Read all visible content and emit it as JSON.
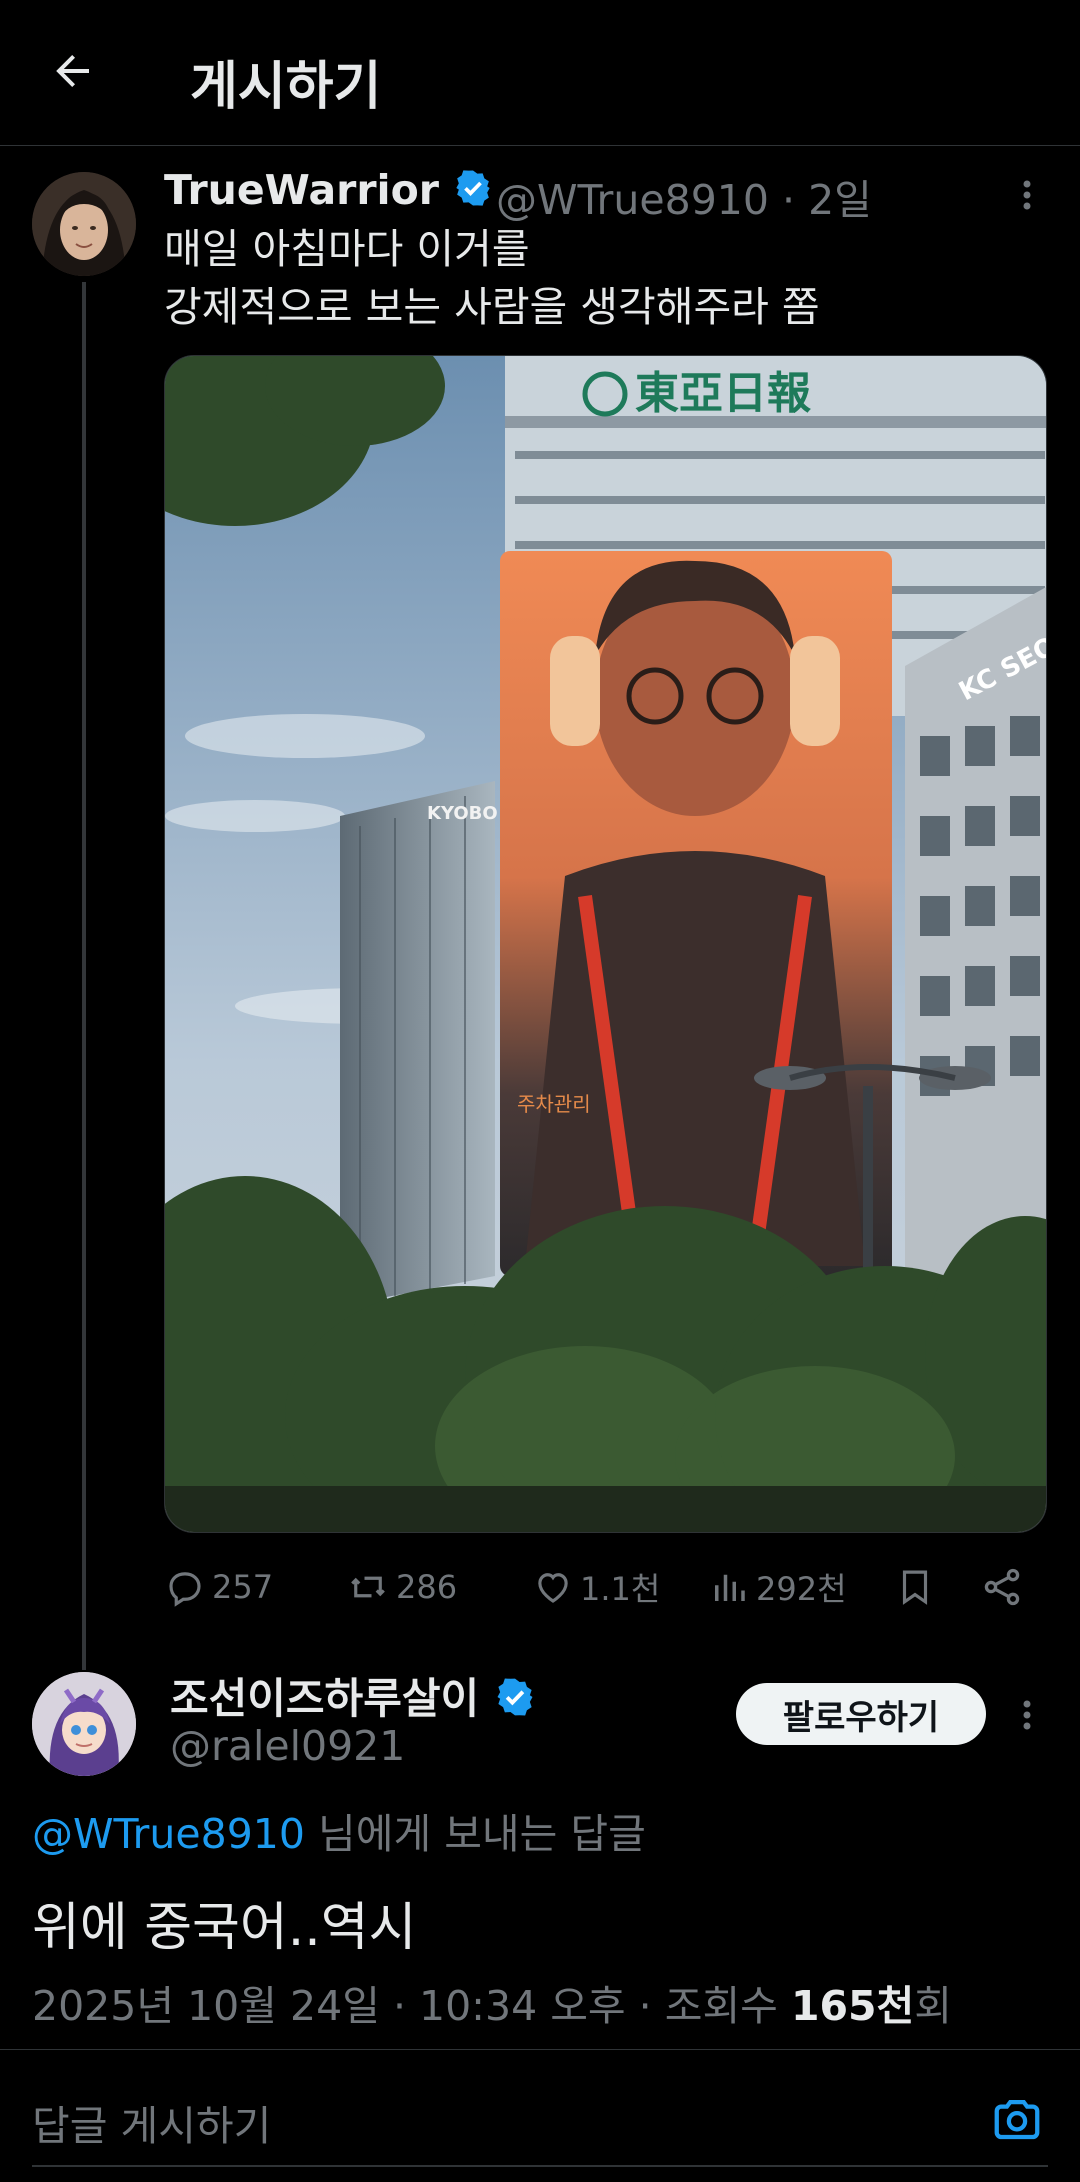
{
  "header": {
    "title": "게시하기"
  },
  "parent_tweet": {
    "display_name": "TrueWarrior",
    "handle": "@WTrue8910",
    "time": "· 2일",
    "text_line1": "매일 아침마다 이거를",
    "text_line2": "강제적으로 보는 사람을 생각해주라 쫌",
    "media": {
      "building_sign": "東亞日報",
      "kyobo_sign": "KYOBO",
      "seoul_sign": "KC SEOUL",
      "billboard_caption": "주차관리"
    },
    "actions": {
      "replies": "257",
      "retweets": "286",
      "likes": "1.1천",
      "views": "292천"
    }
  },
  "reply_tweet": {
    "display_name": "조선이즈하루살이",
    "handle": "@ralel0921",
    "follow_label": "팔로우하기",
    "reply_to_mention": "@WTrue8910",
    "reply_to_suffix": " 님에게 보내는 답글",
    "text": "위에 중국어..역시",
    "meta_prefix": "2025년 10월 24일 · 10:34 오후 · 조회수 ",
    "meta_views": "165천",
    "meta_suffix": "회"
  },
  "composer": {
    "placeholder": "답글 게시하기"
  },
  "colors": {
    "accent": "#1d9bf0",
    "muted": "#71767b",
    "text": "#e7e9ea",
    "background": "#000000"
  }
}
